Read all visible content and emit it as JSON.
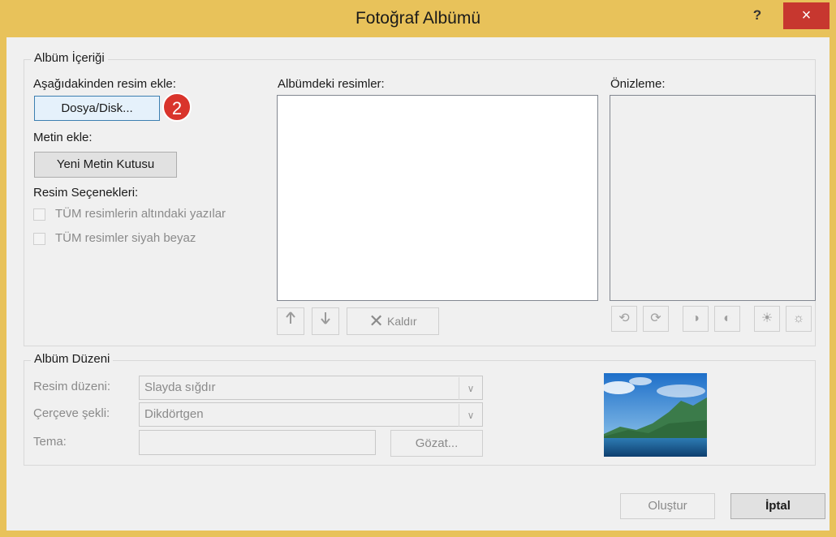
{
  "window": {
    "title": "Fotoğraf Albümü",
    "help": "?",
    "close": "×"
  },
  "content_group": {
    "legend": "Albüm İçeriği",
    "insert_from_label": "Aşağıdakinden resim ekle:",
    "file_disk_button": "Dosya/Disk...",
    "step_badge": "2",
    "insert_text_label": "Metin ekle:",
    "new_textbox_button": "Yeni Metin Kutusu",
    "picture_options_label": "Resim Seçenekleri:",
    "captions_checkbox": "TÜM resimlerin altındaki yazılar",
    "bw_checkbox": "TÜM resimler siyah beyaz",
    "pictures_in_album_label": "Albümdeki resimler:",
    "remove_button": "Kaldır",
    "preview_label": "Önizleme:"
  },
  "layout_group": {
    "legend": "Albüm Düzeni",
    "picture_layout_label": "Resim düzeni:",
    "picture_layout_value": "Slayda sığdır",
    "frame_shape_label": "Çerçeve şekli:",
    "frame_shape_value": "Dikdörtgen",
    "theme_label": "Tema:",
    "theme_value": "",
    "browse_button": "Gözat..."
  },
  "footer": {
    "create_button": "Oluştur",
    "cancel_button": "İptal"
  },
  "icons": [
    "up-arrow-icon",
    "down-arrow-icon",
    "remove-x-icon",
    "rotate-left-icon",
    "rotate-right-icon",
    "contrast-up-icon",
    "contrast-down-icon",
    "brightness-up-icon",
    "brightness-down-icon"
  ]
}
